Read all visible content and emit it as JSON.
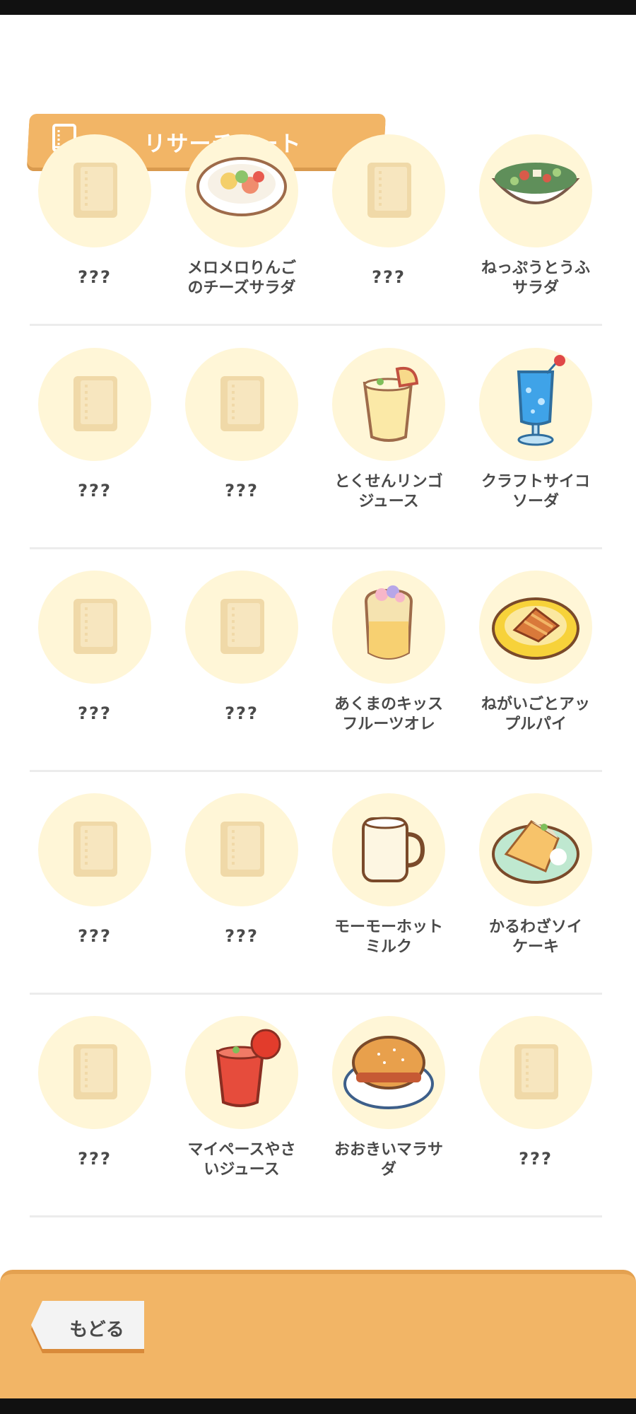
{
  "header": {
    "title": "リサーチノート",
    "icon": "book-icon"
  },
  "items": [
    {
      "label": "???",
      "found": false
    },
    {
      "label": "メロメロりんごのチーズサラダ",
      "line1": "メロメロりんご",
      "line2": "のチーズサラダ",
      "found": true,
      "icon": "apple-cheese-salad-icon"
    },
    {
      "label": "???",
      "found": false
    },
    {
      "label": "ねっぷうとうふサラダ",
      "line1": "ねっぷうとうふ",
      "line2": "サラダ",
      "found": true,
      "icon": "tofu-salad-icon"
    },
    {
      "label": "???",
      "found": false
    },
    {
      "label": "???",
      "found": false
    },
    {
      "label": "とくせんリンゴジュース",
      "line1": "とくせんリンゴ",
      "line2": "ジュース",
      "found": true,
      "icon": "apple-juice-icon"
    },
    {
      "label": "クラフトサイコソーダ",
      "line1": "クラフトサイコ",
      "line2": "ソーダ",
      "found": true,
      "icon": "soda-icon"
    },
    {
      "label": "???",
      "found": false
    },
    {
      "label": "???",
      "found": false
    },
    {
      "label": "あくまのキッスフルーツオレ",
      "line1": "あくまのキッス",
      "line2": "フルーツオレ",
      "found": true,
      "icon": "fruit-au-lait-icon"
    },
    {
      "label": "ねがいごとアップルパイ",
      "line1": "ねがいごとアッ",
      "line2": "プルパイ",
      "found": true,
      "icon": "apple-pie-icon"
    },
    {
      "label": "???",
      "found": false
    },
    {
      "label": "???",
      "found": false
    },
    {
      "label": "モーモーホットミルク",
      "line1": "モーモーホット",
      "line2": "ミルク",
      "found": true,
      "icon": "hot-milk-icon"
    },
    {
      "label": "かるわざソイケーキ",
      "line1": "かるわざソイ",
      "line2": "ケーキ",
      "found": true,
      "icon": "soy-cake-icon"
    },
    {
      "label": "???",
      "found": false
    },
    {
      "label": "マイペースやさいジュース",
      "line1": "マイペースやさ",
      "line2": "いジュース",
      "found": true,
      "icon": "vegetable-juice-icon"
    },
    {
      "label": "おおきいマラサダ",
      "line1": "おおきいマラサ",
      "line2": "ダ",
      "found": true,
      "icon": "malasada-icon"
    },
    {
      "label": "???",
      "found": false
    }
  ],
  "footer": {
    "back_label": "もどる"
  },
  "colors": {
    "accent": "#f2b566",
    "circle": "#fff6d7",
    "book": "#f0d9a8",
    "text": "#4a4a4a"
  }
}
